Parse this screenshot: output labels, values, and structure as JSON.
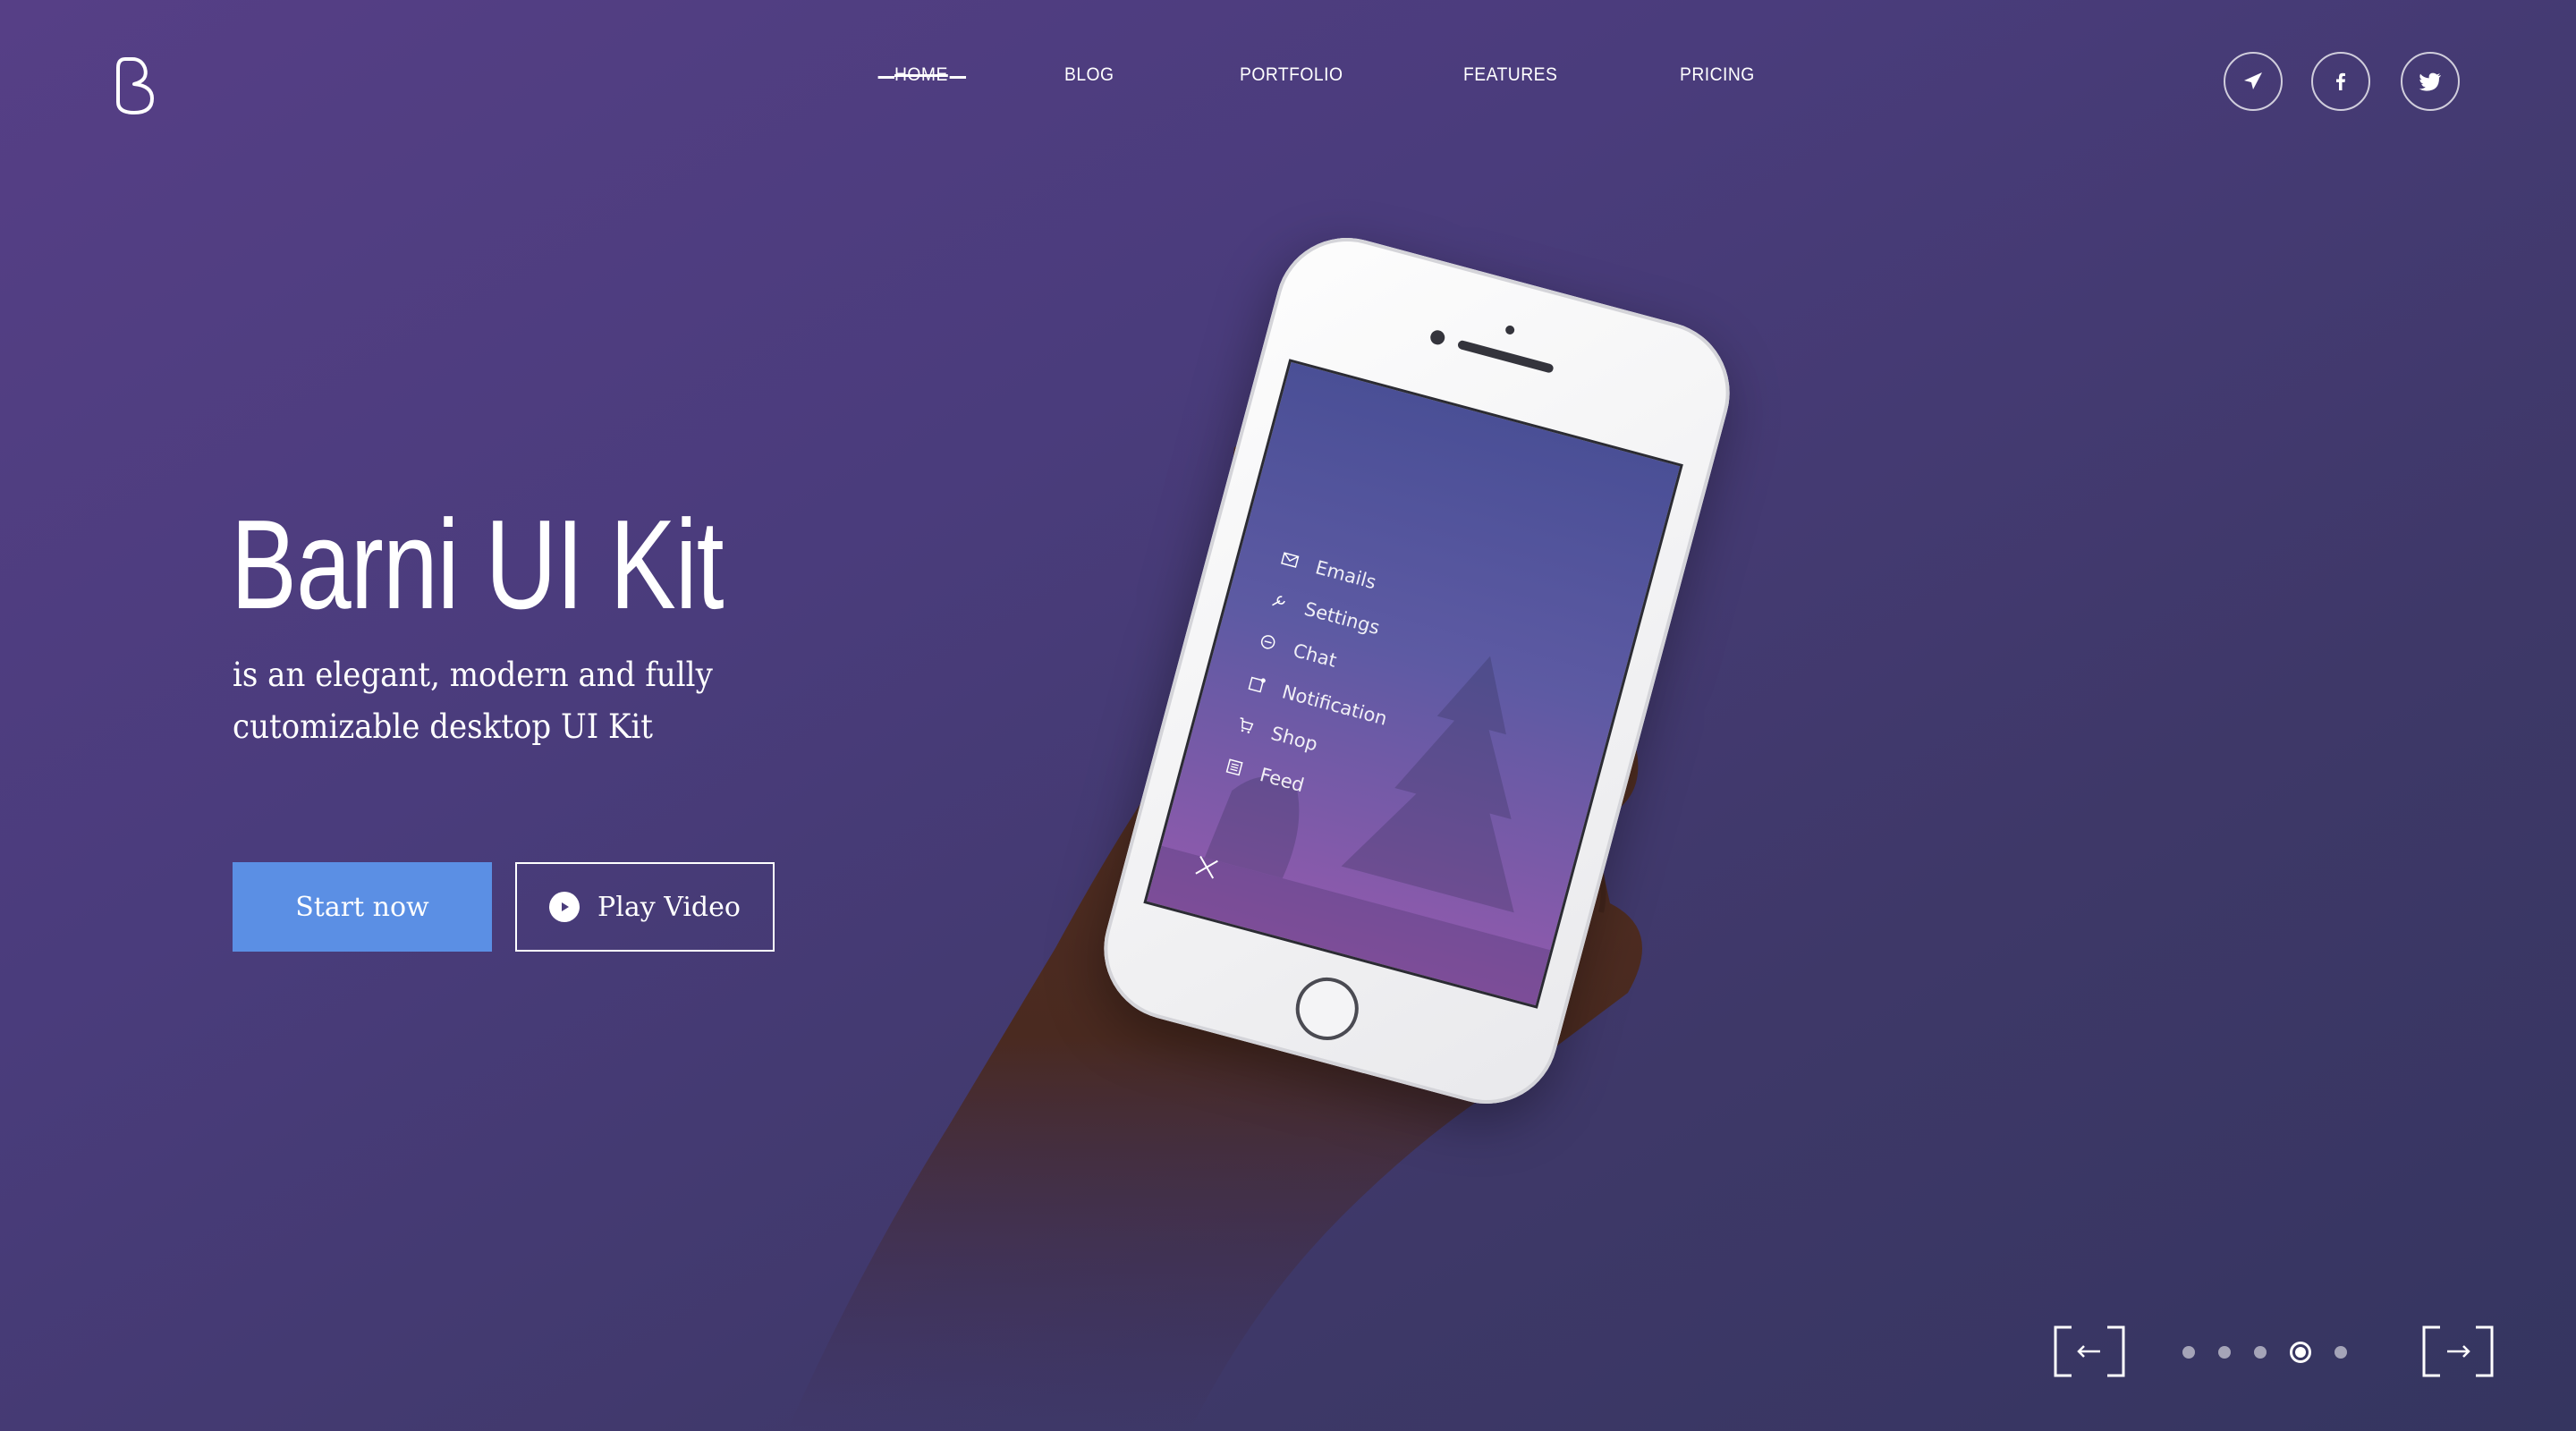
{
  "brand": {
    "logo_icon": "barni-b-logo-icon"
  },
  "nav": {
    "items": [
      {
        "label": "HOME",
        "active": true
      },
      {
        "label": "BLOG",
        "active": false
      },
      {
        "label": "PORTFOLIO",
        "active": false
      },
      {
        "label": "FEATURES",
        "active": false
      },
      {
        "label": "PRICING",
        "active": false
      }
    ]
  },
  "social": [
    {
      "icon": "telegram-icon"
    },
    {
      "icon": "facebook-icon"
    },
    {
      "icon": "twitter-icon"
    }
  ],
  "hero": {
    "title": "Barni UI Kit",
    "subtitle_line1": "is an elegant, modern and fully",
    "subtitle_line2": "cutomizable desktop UI Kit",
    "primary_button": "Start now",
    "secondary_button": "Play Video"
  },
  "phone_menu": {
    "items": [
      {
        "label": "Emails",
        "icon": "mail-icon"
      },
      {
        "label": "Settings",
        "icon": "wrench-icon"
      },
      {
        "label": "Chat",
        "icon": "chat-bubble-icon"
      },
      {
        "label": "Notification",
        "icon": "notification-icon"
      },
      {
        "label": "Shop",
        "icon": "cart-icon"
      },
      {
        "label": "Feed",
        "icon": "feed-icon"
      }
    ],
    "close_icon": "close-icon"
  },
  "slider": {
    "total": 5,
    "current": 4,
    "prev_icon": "arrow-left-icon",
    "next_icon": "arrow-right-icon"
  },
  "colors": {
    "background_top": "#563f86",
    "background_bottom": "#353560",
    "primary_button": "#5b8fe4",
    "text": "#ffffff"
  }
}
